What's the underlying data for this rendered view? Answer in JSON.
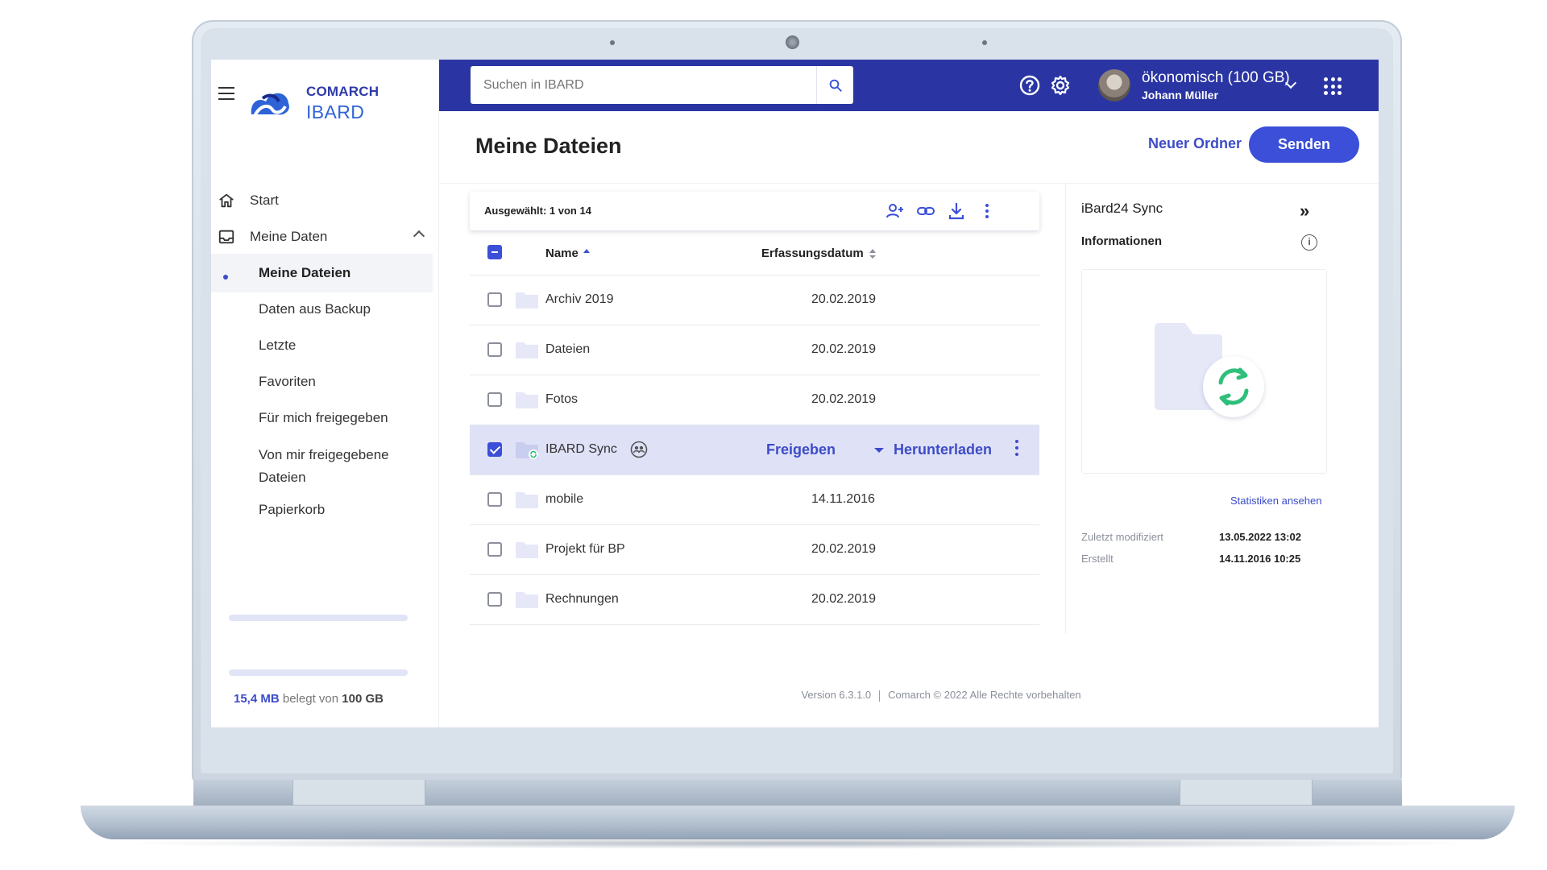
{
  "brand": {
    "line1": "COMARCH",
    "line2": "IBARD"
  },
  "sidebar": {
    "start_label": "Start",
    "my_data_label": "Meine Daten",
    "sub_items": [
      {
        "label": "Meine Dateien"
      },
      {
        "label": "Daten aus Backup"
      },
      {
        "label": "Letzte"
      },
      {
        "label": "Favoriten"
      },
      {
        "label": "Für mich freigegeben"
      },
      {
        "label": "Von mir freigegebene Dateien"
      },
      {
        "label": "Papierkorb"
      }
    ],
    "storage": {
      "used": "15,4 MB",
      "middle": "belegt von",
      "total": "100 GB"
    }
  },
  "topbar": {
    "search_placeholder": "Suchen in IBARD",
    "plan": "ökonomisch (100 GB)",
    "user": "Johann Müller"
  },
  "main": {
    "title": "Meine Dateien",
    "new_folder": "Neuer Ordner",
    "send": "Senden",
    "selection": "Ausgewählt: 1 von 14",
    "columns": {
      "name": "Name",
      "date": "Erfassungsdatum"
    },
    "rows": [
      {
        "name": "Archiv 2019",
        "date": "20.02.2019"
      },
      {
        "name": "Dateien",
        "date": "20.02.2019"
      },
      {
        "name": "Fotos",
        "date": "20.02.2019"
      },
      {
        "name": "IBARD Sync",
        "share_action": "Freigeben",
        "download_action": "Herunterladen"
      },
      {
        "name": "mobile",
        "date": "14.11.2016"
      },
      {
        "name": "Projekt für BP",
        "date": "20.02.2019"
      },
      {
        "name": "Rechnungen",
        "date": "20.02.2019"
      }
    ]
  },
  "panel": {
    "title": "iBard24 Sync",
    "subtitle": "Informationen",
    "stats_link": "Statistiken ansehen",
    "modified_label": "Zuletzt modifiziert",
    "modified_value": "13.05.2022 13:02",
    "created_label": "Erstellt",
    "created_value": "14.11.2016 10:25"
  },
  "footer": {
    "version": "Version 6.3.1.0",
    "copyright": "Comarch © 2022 Alle Rechte vorbehalten"
  },
  "colors": {
    "topbar": "#2a35a3",
    "accent": "#3b4fd8",
    "sync": "#2fbf7a",
    "folder": "#e6e8f8"
  }
}
